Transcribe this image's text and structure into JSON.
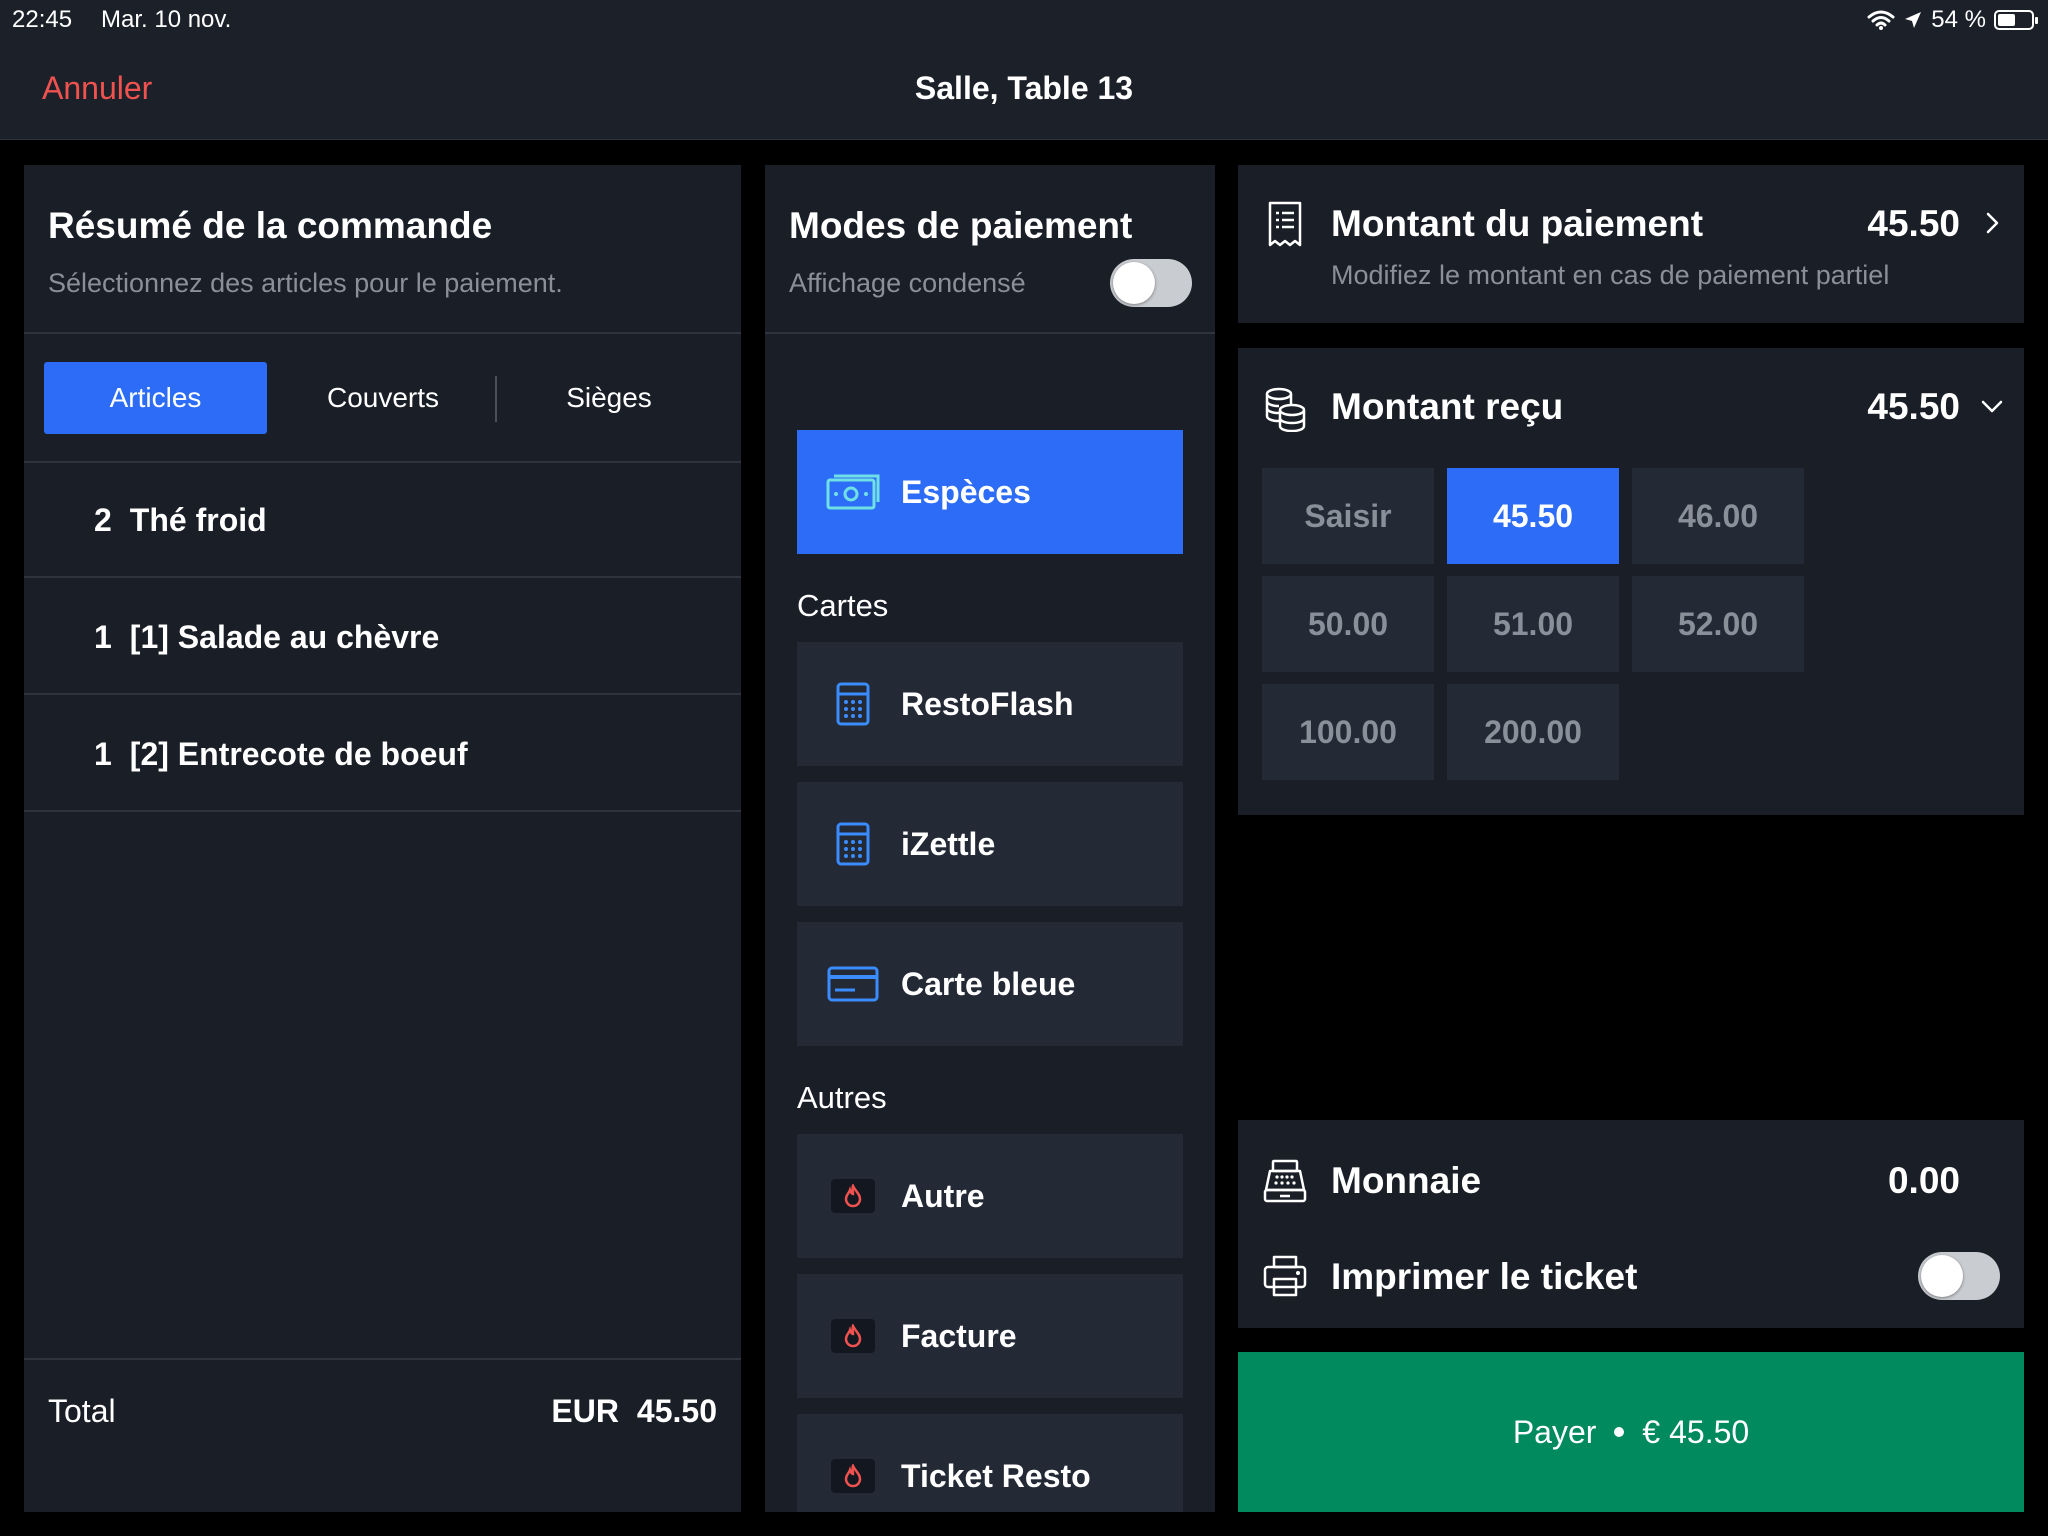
{
  "status_bar": {
    "time": "22:45",
    "date": "Mar. 10 nov.",
    "battery": "54 %",
    "battery_level_percent": 54
  },
  "nav": {
    "cancel_label": "Annuler",
    "title": "Salle, Table 13"
  },
  "order_summary": {
    "title": "Résumé de la commande",
    "subtitle": "Sélectionnez des articles pour le paiement.",
    "tabs": [
      {
        "label": "Articles",
        "active": true
      },
      {
        "label": "Couverts",
        "active": false
      },
      {
        "label": "Sièges",
        "active": false
      }
    ],
    "items": [
      {
        "qty": "2",
        "name": "Thé froid"
      },
      {
        "qty": "1",
        "name": "[1] Salade au chèvre"
      },
      {
        "qty": "1",
        "name": "[2] Entrecote de boeuf"
      }
    ],
    "total_label": "Total",
    "total_currency": "EUR",
    "total_value": "45.50"
  },
  "payment_modes": {
    "title": "Modes de paiement",
    "compact_label": "Affichage condensé",
    "compact_enabled": false,
    "cash": {
      "label": "Espèces",
      "icon": "cash-icon",
      "active": true
    },
    "cards_section": "Cartes",
    "cards": [
      {
        "label": "RestoFlash",
        "icon": "card-terminal-icon"
      },
      {
        "label": "iZettle",
        "icon": "card-terminal-icon"
      },
      {
        "label": "Carte bleue",
        "icon": "credit-card-icon"
      }
    ],
    "others_section": "Autres",
    "others": [
      {
        "label": "Autre",
        "icon": "flame-icon"
      },
      {
        "label": "Facture",
        "icon": "flame-icon"
      },
      {
        "label": "Ticket Resto",
        "icon": "flame-icon"
      }
    ]
  },
  "payment_amount": {
    "title": "Montant du paiement",
    "value": "45.50",
    "subtitle": "Modifiez le montant en cas de paiement partiel"
  },
  "received": {
    "title": "Montant reçu",
    "value": "45.50",
    "quick_amounts": [
      {
        "label": "Saisir",
        "active": false
      },
      {
        "label": "45.50",
        "active": true
      },
      {
        "label": "46.00",
        "active": false
      },
      {
        "label": "50.00",
        "active": false
      },
      {
        "label": "51.00",
        "active": false
      },
      {
        "label": "52.00",
        "active": false
      },
      {
        "label": "100.00",
        "active": false
      },
      {
        "label": "200.00",
        "active": false
      }
    ]
  },
  "change": {
    "title": "Monnaie",
    "value": "0.00"
  },
  "print": {
    "label": "Imprimer le ticket",
    "enabled": false
  },
  "pay_button": {
    "label": "Payer",
    "amount": "€ 45.50"
  },
  "colors": {
    "accent": "#2d6cf6",
    "pay_green": "#008a5e",
    "cancel_red": "#f0524f",
    "panel": "#1a1e26"
  }
}
